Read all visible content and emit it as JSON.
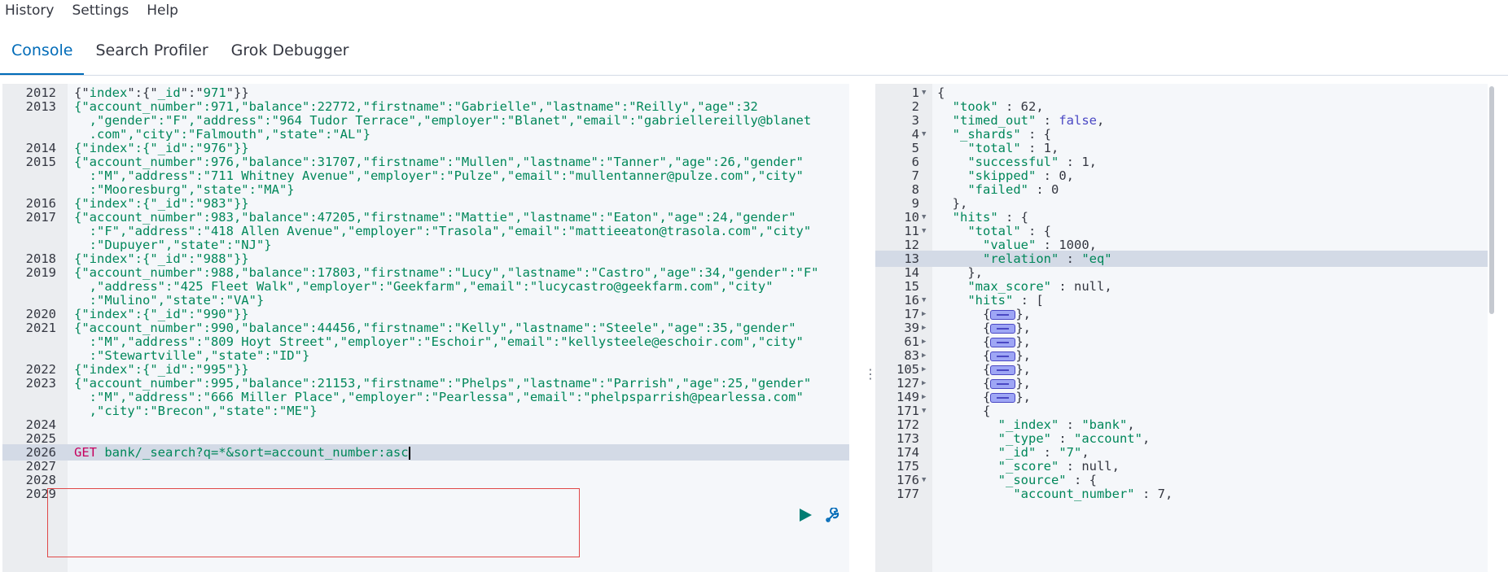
{
  "menu": {
    "history": "History",
    "settings": "Settings",
    "help": "Help"
  },
  "tabs": [
    {
      "label": "Console",
      "active": true
    },
    {
      "label": "Search Profiler",
      "active": false
    },
    {
      "label": "Grok Debugger",
      "active": false
    }
  ],
  "request_editor": {
    "lines": [
      {
        "n": "2012",
        "rows": [
          [
            [
              "{\"",
              "p"
            ],
            [
              "index",
              "s"
            ],
            [
              "\":{\"",
              "p"
            ],
            [
              "_id",
              "s"
            ],
            [
              "\":\"",
              "p"
            ],
            [
              "971",
              "s"
            ],
            [
              "\"}}",
              "p"
            ]
          ]
        ]
      },
      {
        "n": "2013",
        "rows": [
          [
            [
              "{\"account_number\":971,\"balance\":22772,\"firstname\":\"Gabrielle\",\"lastname\":\"Reilly\",\"age\":32",
              "s"
            ]
          ],
          [
            [
              "  ,\"gender\":\"F\",\"address\":\"964 Tudor Terrace\",\"employer\":\"Blanet\",\"email\":\"gabriellereilly@blanet",
              "s"
            ]
          ],
          [
            [
              "  .com\",\"city\":\"Falmouth\",\"state\":\"AL\"}",
              "s"
            ]
          ]
        ]
      },
      {
        "n": "2014",
        "rows": [
          [
            [
              "{\"index\":{\"_id\":\"976\"}}",
              "s"
            ]
          ]
        ]
      },
      {
        "n": "2015",
        "rows": [
          [
            [
              "{\"account_number\":976,\"balance\":31707,\"firstname\":\"Mullen\",\"lastname\":\"Tanner\",\"age\":26,\"gender\"",
              "s"
            ]
          ],
          [
            [
              "  :\"M\",\"address\":\"711 Whitney Avenue\",\"employer\":\"Pulze\",\"email\":\"mullentanner@pulze.com\",\"city\"",
              "s"
            ]
          ],
          [
            [
              "  :\"Mooresburg\",\"state\":\"MA\"}",
              "s"
            ]
          ]
        ]
      },
      {
        "n": "2016",
        "rows": [
          [
            [
              "{\"index\":{\"_id\":\"983\"}}",
              "s"
            ]
          ]
        ]
      },
      {
        "n": "2017",
        "rows": [
          [
            [
              "{\"account_number\":983,\"balance\":47205,\"firstname\":\"Mattie\",\"lastname\":\"Eaton\",\"age\":24,\"gender\"",
              "s"
            ]
          ],
          [
            [
              "  :\"F\",\"address\":\"418 Allen Avenue\",\"employer\":\"Trasola\",\"email\":\"mattieeaton@trasola.com\",\"city\"",
              "s"
            ]
          ],
          [
            [
              "  :\"Dupuyer\",\"state\":\"NJ\"}",
              "s"
            ]
          ]
        ]
      },
      {
        "n": "2018",
        "rows": [
          [
            [
              "{\"index\":{\"_id\":\"988\"}}",
              "s"
            ]
          ]
        ]
      },
      {
        "n": "2019",
        "rows": [
          [
            [
              "{\"account_number\":988,\"balance\":17803,\"firstname\":\"Lucy\",\"lastname\":\"Castro\",\"age\":34,\"gender\":\"F\"",
              "s"
            ]
          ],
          [
            [
              "  ,\"address\":\"425 Fleet Walk\",\"employer\":\"Geekfarm\",\"email\":\"lucycastro@geekfarm.com\",\"city\"",
              "s"
            ]
          ],
          [
            [
              "  :\"Mulino\",\"state\":\"VA\"}",
              "s"
            ]
          ]
        ]
      },
      {
        "n": "2020",
        "rows": [
          [
            [
              "{\"index\":{\"_id\":\"990\"}}",
              "s"
            ]
          ]
        ]
      },
      {
        "n": "2021",
        "rows": [
          [
            [
              "{\"account_number\":990,\"balance\":44456,\"firstname\":\"Kelly\",\"lastname\":\"Steele\",\"age\":35,\"gender\"",
              "s"
            ]
          ],
          [
            [
              "  :\"M\",\"address\":\"809 Hoyt Street\",\"employer\":\"Eschoir\",\"email\":\"kellysteele@eschoir.com\",\"city\"",
              "s"
            ]
          ],
          [
            [
              "  :\"Stewartville\",\"state\":\"ID\"}",
              "s"
            ]
          ]
        ]
      },
      {
        "n": "2022",
        "rows": [
          [
            [
              "{\"index\":{\"_id\":\"995\"}}",
              "s"
            ]
          ]
        ]
      },
      {
        "n": "2023",
        "rows": [
          [
            [
              "{\"account_number\":995,\"balance\":21153,\"firstname\":\"Phelps\",\"lastname\":\"Parrish\",\"age\":25,\"gender\"",
              "s"
            ]
          ],
          [
            [
              "  :\"M\",\"address\":\"666 Miller Place\",\"employer\":\"Pearlessa\",\"email\":\"phelpsparrish@pearlessa.com\"",
              "s"
            ]
          ],
          [
            [
              "  ,\"city\":\"Brecon\",\"state\":\"ME\"}",
              "s"
            ]
          ]
        ]
      },
      {
        "n": "2024",
        "rows": [
          []
        ]
      },
      {
        "n": "2025",
        "rows": [
          []
        ]
      },
      {
        "n": "2026",
        "rows": [
          [
            [
              "GET ",
              "m"
            ],
            [
              "bank/_search?q=*&sort=account_number:asc",
              "s"
            ]
          ]
        ],
        "current": true
      },
      {
        "n": "2027",
        "rows": [
          []
        ]
      },
      {
        "n": "2028",
        "rows": [
          []
        ]
      },
      {
        "n": "2029",
        "rows": [
          []
        ]
      }
    ]
  },
  "response_viewer": {
    "lines": [
      {
        "n": "1",
        "fold": "open",
        "t": [
          [
            "{",
            "p"
          ]
        ]
      },
      {
        "n": "2",
        "t": [
          [
            "  \"took\"",
            "s"
          ],
          [
            " : ",
            "p"
          ],
          [
            "62",
            "n"
          ],
          [
            ",",
            "p"
          ]
        ]
      },
      {
        "n": "3",
        "t": [
          [
            "  \"timed_out\"",
            "s"
          ],
          [
            " : ",
            "p"
          ],
          [
            "false",
            "b"
          ],
          [
            ",",
            "p"
          ]
        ]
      },
      {
        "n": "4",
        "fold": "open",
        "t": [
          [
            "  \"_shards\"",
            "s"
          ],
          [
            " : {",
            "p"
          ]
        ]
      },
      {
        "n": "5",
        "t": [
          [
            "    \"total\"",
            "s"
          ],
          [
            " : ",
            "p"
          ],
          [
            "1",
            "n"
          ],
          [
            ",",
            "p"
          ]
        ]
      },
      {
        "n": "6",
        "t": [
          [
            "    \"successful\"",
            "s"
          ],
          [
            " : ",
            "p"
          ],
          [
            "1",
            "n"
          ],
          [
            ",",
            "p"
          ]
        ]
      },
      {
        "n": "7",
        "t": [
          [
            "    \"skipped\"",
            "s"
          ],
          [
            " : ",
            "p"
          ],
          [
            "0",
            "n"
          ],
          [
            ",",
            "p"
          ]
        ]
      },
      {
        "n": "8",
        "t": [
          [
            "    \"failed\"",
            "s"
          ],
          [
            " : ",
            "p"
          ],
          [
            "0",
            "n"
          ]
        ]
      },
      {
        "n": "9",
        "fold": "end",
        "t": [
          [
            "  },",
            "p"
          ]
        ]
      },
      {
        "n": "10",
        "fold": "open",
        "t": [
          [
            "  \"hits\"",
            "s"
          ],
          [
            " : {",
            "p"
          ]
        ]
      },
      {
        "n": "11",
        "fold": "open",
        "t": [
          [
            "    \"total\"",
            "s"
          ],
          [
            " : {",
            "p"
          ]
        ]
      },
      {
        "n": "12",
        "t": [
          [
            "      \"value\"",
            "s"
          ],
          [
            " : ",
            "p"
          ],
          [
            "1000",
            "n"
          ],
          [
            ",",
            "p"
          ]
        ]
      },
      {
        "n": "13",
        "t": [
          [
            "      \"relation\"",
            "s"
          ],
          [
            " : ",
            "p"
          ],
          [
            "\"eq\"",
            "s"
          ]
        ],
        "current": true
      },
      {
        "n": "14",
        "fold": "end",
        "t": [
          [
            "    },",
            "p"
          ]
        ]
      },
      {
        "n": "15",
        "t": [
          [
            "    \"max_score\"",
            "s"
          ],
          [
            " : ",
            "p"
          ],
          [
            "null",
            "n"
          ],
          [
            ",",
            "p"
          ]
        ]
      },
      {
        "n": "16",
        "fold": "open",
        "t": [
          [
            "    \"hits\"",
            "s"
          ],
          [
            " : [",
            "p"
          ]
        ]
      },
      {
        "n": "17",
        "fold": "closed",
        "t": [
          [
            "      {",
            "p"
          ],
          [
            "#PH",
            "ph"
          ],
          [
            "},",
            "p"
          ]
        ]
      },
      {
        "n": "39",
        "fold": "closed",
        "t": [
          [
            "      {",
            "p"
          ],
          [
            "#PH",
            "ph"
          ],
          [
            "},",
            "p"
          ]
        ]
      },
      {
        "n": "61",
        "fold": "closed",
        "t": [
          [
            "      {",
            "p"
          ],
          [
            "#PH",
            "ph"
          ],
          [
            "},",
            "p"
          ]
        ]
      },
      {
        "n": "83",
        "fold": "closed",
        "t": [
          [
            "      {",
            "p"
          ],
          [
            "#PH",
            "ph"
          ],
          [
            "},",
            "p"
          ]
        ]
      },
      {
        "n": "105",
        "fold": "closed",
        "t": [
          [
            "      {",
            "p"
          ],
          [
            "#PH",
            "ph"
          ],
          [
            "},",
            "p"
          ]
        ]
      },
      {
        "n": "127",
        "fold": "closed",
        "t": [
          [
            "      {",
            "p"
          ],
          [
            "#PH",
            "ph"
          ],
          [
            "},",
            "p"
          ]
        ]
      },
      {
        "n": "149",
        "fold": "closed",
        "t": [
          [
            "      {",
            "p"
          ],
          [
            "#PH",
            "ph"
          ],
          [
            "},",
            "p"
          ]
        ]
      },
      {
        "n": "171",
        "fold": "open",
        "t": [
          [
            "      {",
            "p"
          ]
        ]
      },
      {
        "n": "172",
        "t": [
          [
            "        \"_index\"",
            "s"
          ],
          [
            " : ",
            "p"
          ],
          [
            "\"bank\"",
            "s"
          ],
          [
            ",",
            "p"
          ]
        ]
      },
      {
        "n": "173",
        "t": [
          [
            "        \"_type\"",
            "s"
          ],
          [
            " : ",
            "p"
          ],
          [
            "\"account\"",
            "s"
          ],
          [
            ",",
            "p"
          ]
        ]
      },
      {
        "n": "174",
        "t": [
          [
            "        \"_id\"",
            "s"
          ],
          [
            " : ",
            "p"
          ],
          [
            "\"7\"",
            "s"
          ],
          [
            ",",
            "p"
          ]
        ]
      },
      {
        "n": "175",
        "t": [
          [
            "        \"_score\"",
            "s"
          ],
          [
            " : ",
            "p"
          ],
          [
            "null",
            "n"
          ],
          [
            ",",
            "p"
          ]
        ]
      },
      {
        "n": "176",
        "fold": "open",
        "t": [
          [
            "        \"_source\"",
            "s"
          ],
          [
            " : {",
            "p"
          ]
        ]
      },
      {
        "n": "177",
        "t": [
          [
            "          \"account_number\"",
            "s"
          ],
          [
            " : ",
            "p"
          ],
          [
            "7",
            "n"
          ],
          [
            ",",
            "p"
          ]
        ]
      }
    ]
  },
  "icons": {
    "run": "play-icon",
    "settings": "wrench-icon",
    "divider": "vertical-ellipsis-icon"
  },
  "colors": {
    "accent": "#006bb8",
    "string": "#00875a",
    "method": "#c6005f",
    "selection": "#e04848"
  }
}
